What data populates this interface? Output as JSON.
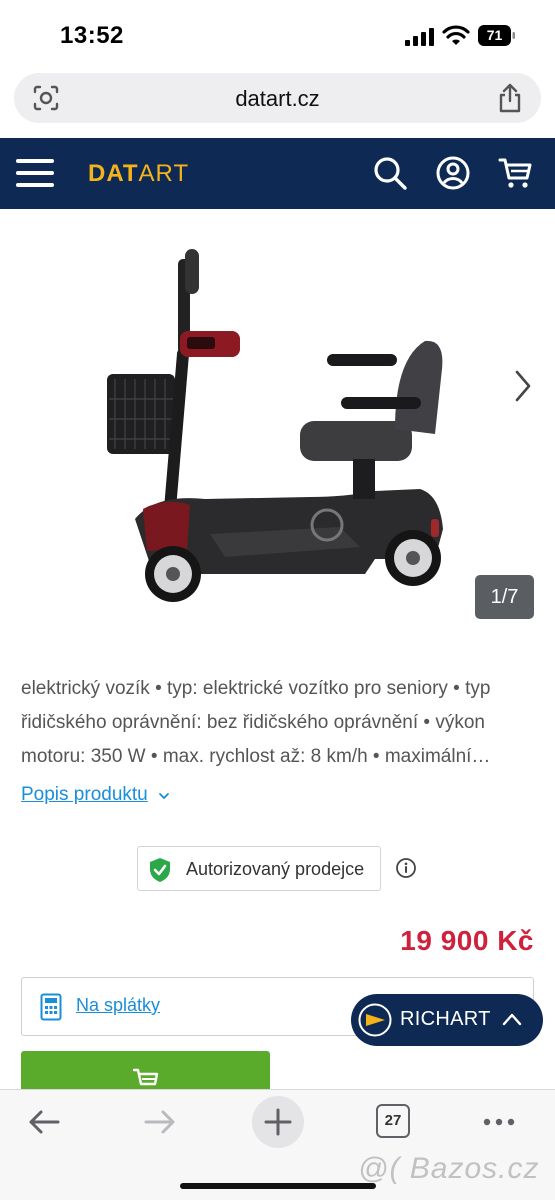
{
  "status_bar": {
    "time": "13:52",
    "battery": "71"
  },
  "browser": {
    "url": "datart.cz"
  },
  "header": {
    "logo_part1": "DAT",
    "logo_part2": "ART",
    "brand_color": "#0e2a54",
    "logo_color": "#f5b31b"
  },
  "gallery": {
    "counter": "1/7"
  },
  "product": {
    "description": "elektrický vozík • typ: elektrické vozítko pro seniory • typ řidičského oprávnění: bez řidičského oprávnění • výkon motoru: 350 W • max. rychlost až: 8 km/h • maximální…",
    "description_link": "Popis produktu",
    "authorized_seller": "Autorizovaný prodejce",
    "price": "19 900 Kč",
    "installments_label": "Na splátky"
  },
  "chat": {
    "agent_name": "RICHART"
  },
  "toolbar": {
    "tabs_count": "27"
  },
  "watermark": "@( Bazos.cz",
  "colors": {
    "price": "#d0213c",
    "link": "#1a8ed8",
    "cart_button": "#5aaa2c",
    "verified": "#2ba84a"
  }
}
